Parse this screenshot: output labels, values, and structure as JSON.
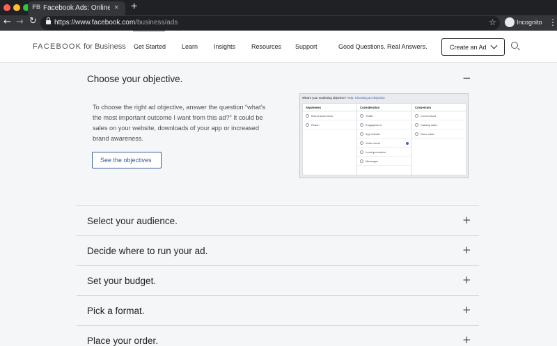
{
  "browser": {
    "tab_favicon": "FB",
    "tab_title": "Facebook Ads: Online Advertising",
    "tab_close": "×",
    "new_tab": "+",
    "url_host": "https://www.facebook.com",
    "url_path": "/business/ads",
    "incognito_label": "Incognito",
    "icons": [
      "back-icon",
      "forward-icon",
      "reload-icon",
      "lock-icon",
      "star-icon",
      "incognito-icon",
      "menu-icon"
    ]
  },
  "header": {
    "logo_brand": "FACEBOOK",
    "logo_suffix": " for Business",
    "nav": [
      "Get Started",
      "Learn",
      "Insights",
      "Resources",
      "Support",
      "Good Questions. Real Answers."
    ],
    "active_nav": "Get Started",
    "cta_label": "Create an Ad"
  },
  "accordion": {
    "expanded": {
      "title": "Choose your objective.",
      "toggle": "−",
      "text": "To choose the right ad objective, answer the question “what’s the most important outcome I want from this ad?” It could be sales on your website, downloads of your app or increased brand awareness.",
      "button_label": "See the objectives"
    },
    "items": [
      {
        "title": "Select your audience.",
        "toggle": "+"
      },
      {
        "title": "Decide where to run your ad.",
        "toggle": "+"
      },
      {
        "title": "Set your budget.",
        "toggle": "+"
      },
      {
        "title": "Pick a format.",
        "toggle": "+"
      },
      {
        "title": "Place your order.",
        "toggle": "+"
      }
    ]
  },
  "objective_preview": {
    "question": "What's your marketing objective?",
    "help_link": "Help: Choosing an Objective",
    "columns": [
      {
        "heading": "Awareness",
        "items": [
          "Brand awareness",
          "Reach"
        ]
      },
      {
        "heading": "Consideration",
        "items": [
          "Traffic",
          "Engagement",
          "App installs",
          "Video views",
          "Lead generation",
          "Messages"
        ]
      },
      {
        "heading": "Conversion",
        "items": [
          "Conversions",
          "Catalog sales",
          "Store visits"
        ]
      }
    ]
  },
  "colors": {
    "accent": "#365899",
    "text": "#1c1e21",
    "muted": "#4b4f56",
    "page_bg": "#f5f6f7"
  }
}
